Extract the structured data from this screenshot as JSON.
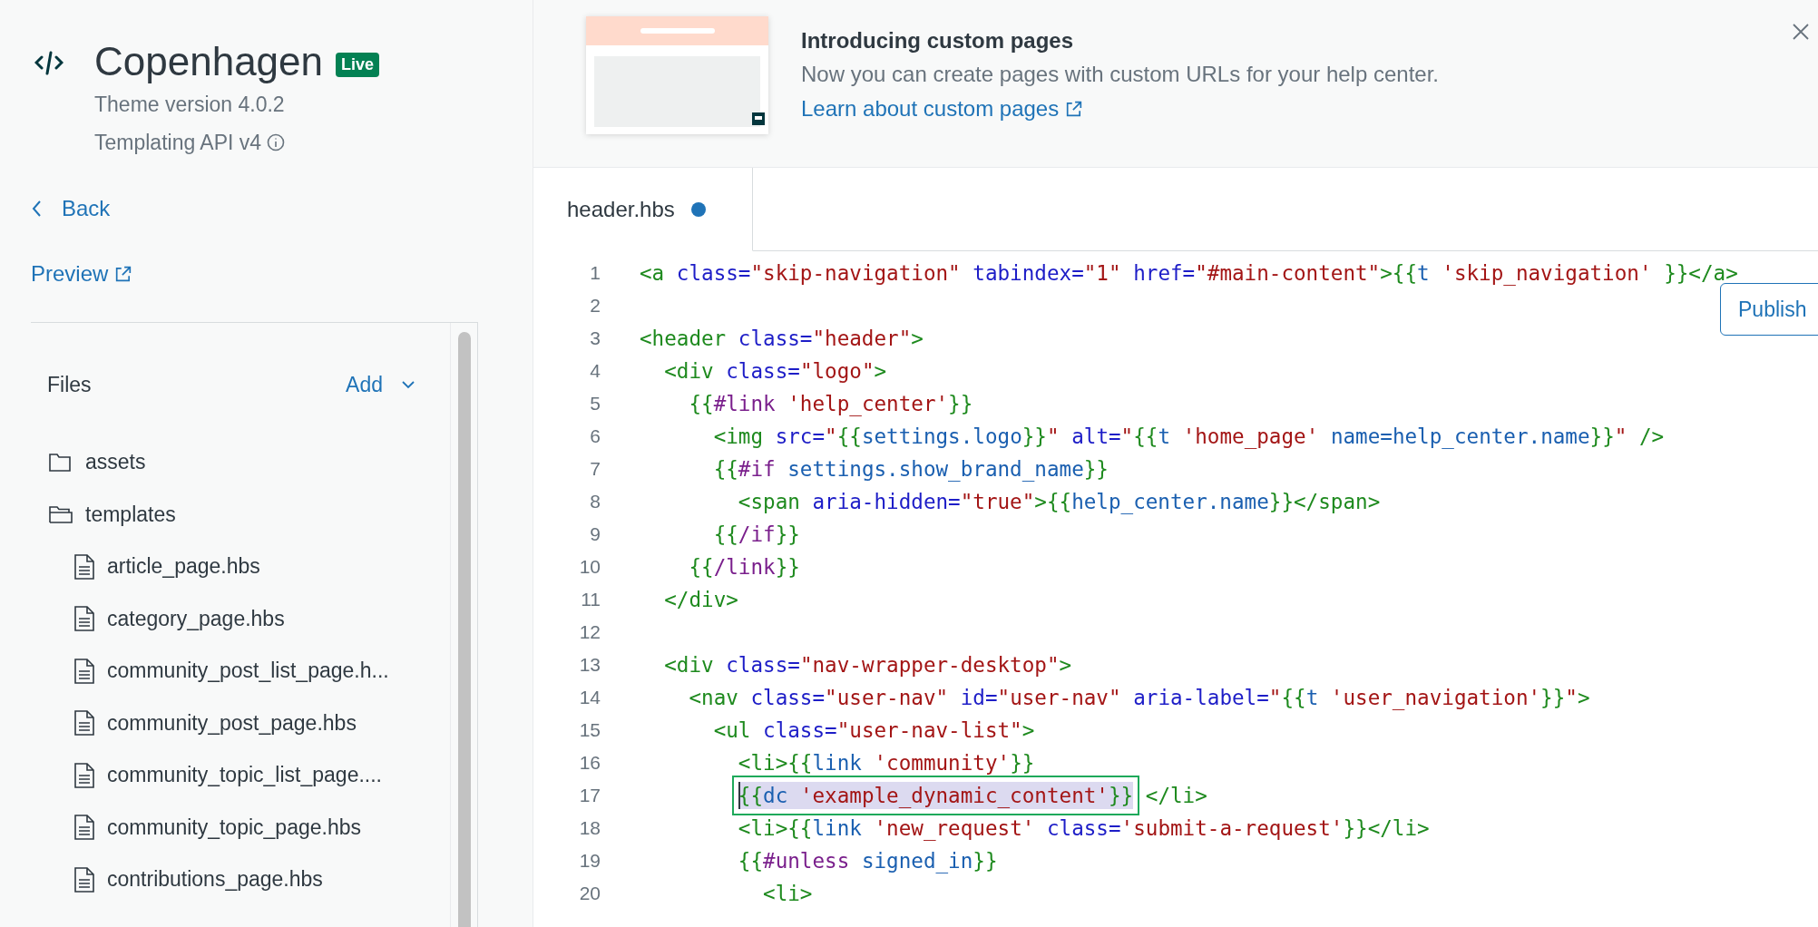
{
  "sidebar": {
    "theme": {
      "name": "Copenhagen",
      "badge": "Live",
      "version": "Theme version 4.0.2",
      "api": "Templating API v4"
    },
    "back_link": "Back",
    "preview_link": "Preview",
    "files": {
      "title": "Files",
      "add_button": "Add",
      "items": [
        {
          "label": "assets",
          "kind": "folder",
          "expanded": false
        },
        {
          "label": "templates",
          "kind": "folder",
          "expanded": true,
          "children": [
            {
              "label": "article_page.hbs",
              "kind": "file"
            },
            {
              "label": "category_page.hbs",
              "kind": "file"
            },
            {
              "label": "community_post_list_page.h...",
              "kind": "file"
            },
            {
              "label": "community_post_page.hbs",
              "kind": "file"
            },
            {
              "label": "community_topic_list_page....",
              "kind": "file"
            },
            {
              "label": "community_topic_page.hbs",
              "kind": "file"
            },
            {
              "label": "contributions_page.hbs",
              "kind": "file"
            }
          ]
        }
      ]
    }
  },
  "banner": {
    "title": "Introducing custom pages",
    "description": "Now you can create pages with custom URLs for your help center.",
    "link": "Learn about custom pages"
  },
  "editor": {
    "tabs": [
      {
        "label": "header.hbs",
        "selected": true,
        "unsaved": true
      }
    ],
    "publish_button": "Publish",
    "lines": [
      {
        "number": "1",
        "tokens": [
          {
            "kind": "tag",
            "text": "<a"
          },
          {
            "kind": "attr",
            "text": " class="
          },
          {
            "kind": "string",
            "text": "\"skip-navigation\""
          },
          {
            "kind": "attr",
            "text": " tabindex="
          },
          {
            "kind": "string",
            "text": "\"1\""
          },
          {
            "kind": "attr",
            "text": " href="
          },
          {
            "kind": "string",
            "text": "\"#main-content\""
          },
          {
            "kind": "tag",
            "text": ">"
          },
          {
            "kind": "brace",
            "text": "{{"
          },
          {
            "kind": "var",
            "text": "t"
          },
          {
            "kind": "string",
            "text": " 'skip_navigation'"
          },
          {
            "kind": "brace",
            "text": " }}"
          },
          {
            "kind": "tag",
            "text": "</a>"
          }
        ]
      },
      {
        "number": "2"
      },
      {
        "number": "3",
        "tokens": [
          {
            "kind": "tag",
            "text": "<header"
          },
          {
            "kind": "attr",
            "text": " class="
          },
          {
            "kind": "string",
            "text": "\"header\""
          },
          {
            "kind": "tag",
            "text": ">"
          }
        ]
      },
      {
        "number": "4",
        "tokens": [
          {
            "kind": "tag",
            "text": "  <div"
          },
          {
            "kind": "attr",
            "text": " class="
          },
          {
            "kind": "string",
            "text": "\"logo\""
          },
          {
            "kind": "tag",
            "text": ">"
          }
        ]
      },
      {
        "number": "5",
        "tokens": [
          {
            "kind": "brace",
            "text": "    {{"
          },
          {
            "kind": "helper",
            "text": "#link"
          },
          {
            "kind": "string",
            "text": " 'help_center'"
          },
          {
            "kind": "brace",
            "text": "}}"
          }
        ]
      },
      {
        "number": "6",
        "tokens": [
          {
            "kind": "tag",
            "text": "      <img"
          },
          {
            "kind": "attr",
            "text": " src="
          },
          {
            "kind": "string",
            "text": "\""
          },
          {
            "kind": "brace",
            "text": "{{"
          },
          {
            "kind": "var",
            "text": "settings.logo"
          },
          {
            "kind": "brace",
            "text": "}}"
          },
          {
            "kind": "string",
            "text": "\""
          },
          {
            "kind": "attr",
            "text": " alt="
          },
          {
            "kind": "string",
            "text": "\""
          },
          {
            "kind": "brace",
            "text": "{{"
          },
          {
            "kind": "var",
            "text": "t"
          },
          {
            "kind": "string",
            "text": " 'home_page'"
          },
          {
            "kind": "var",
            "text": " name=help_center.name"
          },
          {
            "kind": "brace",
            "text": "}}"
          },
          {
            "kind": "string",
            "text": "\""
          },
          {
            "kind": "tag",
            "text": " />"
          }
        ]
      },
      {
        "number": "7",
        "tokens": [
          {
            "kind": "brace",
            "text": "      {{"
          },
          {
            "kind": "helper",
            "text": "#if"
          },
          {
            "kind": "var",
            "text": " settings.show_brand_name"
          },
          {
            "kind": "brace",
            "text": "}}"
          }
        ]
      },
      {
        "number": "8",
        "tokens": [
          {
            "kind": "tag",
            "text": "        <span"
          },
          {
            "kind": "attr",
            "text": " aria-hidden="
          },
          {
            "kind": "string",
            "text": "\"true\""
          },
          {
            "kind": "tag",
            "text": ">"
          },
          {
            "kind": "brace",
            "text": "{{"
          },
          {
            "kind": "var",
            "text": "help_center.name"
          },
          {
            "kind": "brace",
            "text": "}}"
          },
          {
            "kind": "tag",
            "text": "</span>"
          }
        ]
      },
      {
        "number": "9",
        "tokens": [
          {
            "kind": "brace",
            "text": "      {{"
          },
          {
            "kind": "helper",
            "text": "/if"
          },
          {
            "kind": "brace",
            "text": "}}"
          }
        ]
      },
      {
        "number": "10",
        "tokens": [
          {
            "kind": "brace",
            "text": "    {{"
          },
          {
            "kind": "helper",
            "text": "/link"
          },
          {
            "kind": "brace",
            "text": "}}"
          }
        ]
      },
      {
        "number": "11",
        "tokens": [
          {
            "kind": "tag",
            "text": "  </div>"
          }
        ]
      },
      {
        "number": "12"
      },
      {
        "number": "13",
        "tokens": [
          {
            "kind": "tag",
            "text": "  <div"
          },
          {
            "kind": "attr",
            "text": " class="
          },
          {
            "kind": "string",
            "text": "\"nav-wrapper-desktop\""
          },
          {
            "kind": "tag",
            "text": ">"
          }
        ]
      },
      {
        "number": "14",
        "tokens": [
          {
            "kind": "tag",
            "text": "    <nav"
          },
          {
            "kind": "attr",
            "text": " class="
          },
          {
            "kind": "string",
            "text": "\"user-nav\""
          },
          {
            "kind": "attr",
            "text": " id="
          },
          {
            "kind": "string",
            "text": "\"user-nav\""
          },
          {
            "kind": "attr",
            "text": " aria-label="
          },
          {
            "kind": "string",
            "text": "\""
          },
          {
            "kind": "brace",
            "text": "{{"
          },
          {
            "kind": "var",
            "text": "t"
          },
          {
            "kind": "string",
            "text": " 'user_navigation'"
          },
          {
            "kind": "brace",
            "text": "}}"
          },
          {
            "kind": "string",
            "text": "\""
          },
          {
            "kind": "tag",
            "text": ">"
          }
        ]
      },
      {
        "number": "15",
        "tokens": [
          {
            "kind": "tag",
            "text": "      <ul"
          },
          {
            "kind": "attr",
            "text": " class="
          },
          {
            "kind": "string",
            "text": "\"user-nav-list\""
          },
          {
            "kind": "tag",
            "text": ">"
          }
        ]
      },
      {
        "number": "16",
        "tokens": [
          {
            "kind": "tag",
            "text": "        <li>"
          },
          {
            "kind": "brace",
            "text": "{{"
          },
          {
            "kind": "var",
            "text": "link"
          },
          {
            "kind": "string",
            "text": " 'community'"
          },
          {
            "kind": "brace",
            "text": "}}"
          }
        ]
      },
      {
        "number": "17",
        "tokens": [
          {
            "kind": "selection",
            "highlighted": true,
            "outlined": true,
            "tokens": [
              {
                "kind": "brace",
                "text": "        {{"
              },
              {
                "kind": "var",
                "text": "dc"
              },
              {
                "kind": "string",
                "text": " 'example_dynamic_content'"
              },
              {
                "kind": "brace",
                "text": "}}"
              }
            ]
          },
          {
            "kind": "tag",
            "text": " </li>"
          }
        ]
      },
      {
        "number": "18",
        "tokens": [
          {
            "kind": "tag",
            "text": "        <li>"
          },
          {
            "kind": "brace",
            "text": "{{"
          },
          {
            "kind": "var",
            "text": "link"
          },
          {
            "kind": "string",
            "text": " 'new_request'"
          },
          {
            "kind": "attr",
            "text": " class="
          },
          {
            "kind": "string",
            "text": "'submit-a-request'"
          },
          {
            "kind": "brace",
            "text": "}}"
          },
          {
            "kind": "tag",
            "text": "</li>"
          }
        ]
      },
      {
        "number": "19",
        "tokens": [
          {
            "kind": "brace",
            "text": "        {{"
          },
          {
            "kind": "helper",
            "text": "#unless"
          },
          {
            "kind": "var",
            "text": " signed_in"
          },
          {
            "kind": "brace",
            "text": "}}"
          }
        ]
      },
      {
        "number": "20",
        "tokens": [
          {
            "kind": "tag",
            "text": "          <li>"
          }
        ]
      }
    ]
  }
}
